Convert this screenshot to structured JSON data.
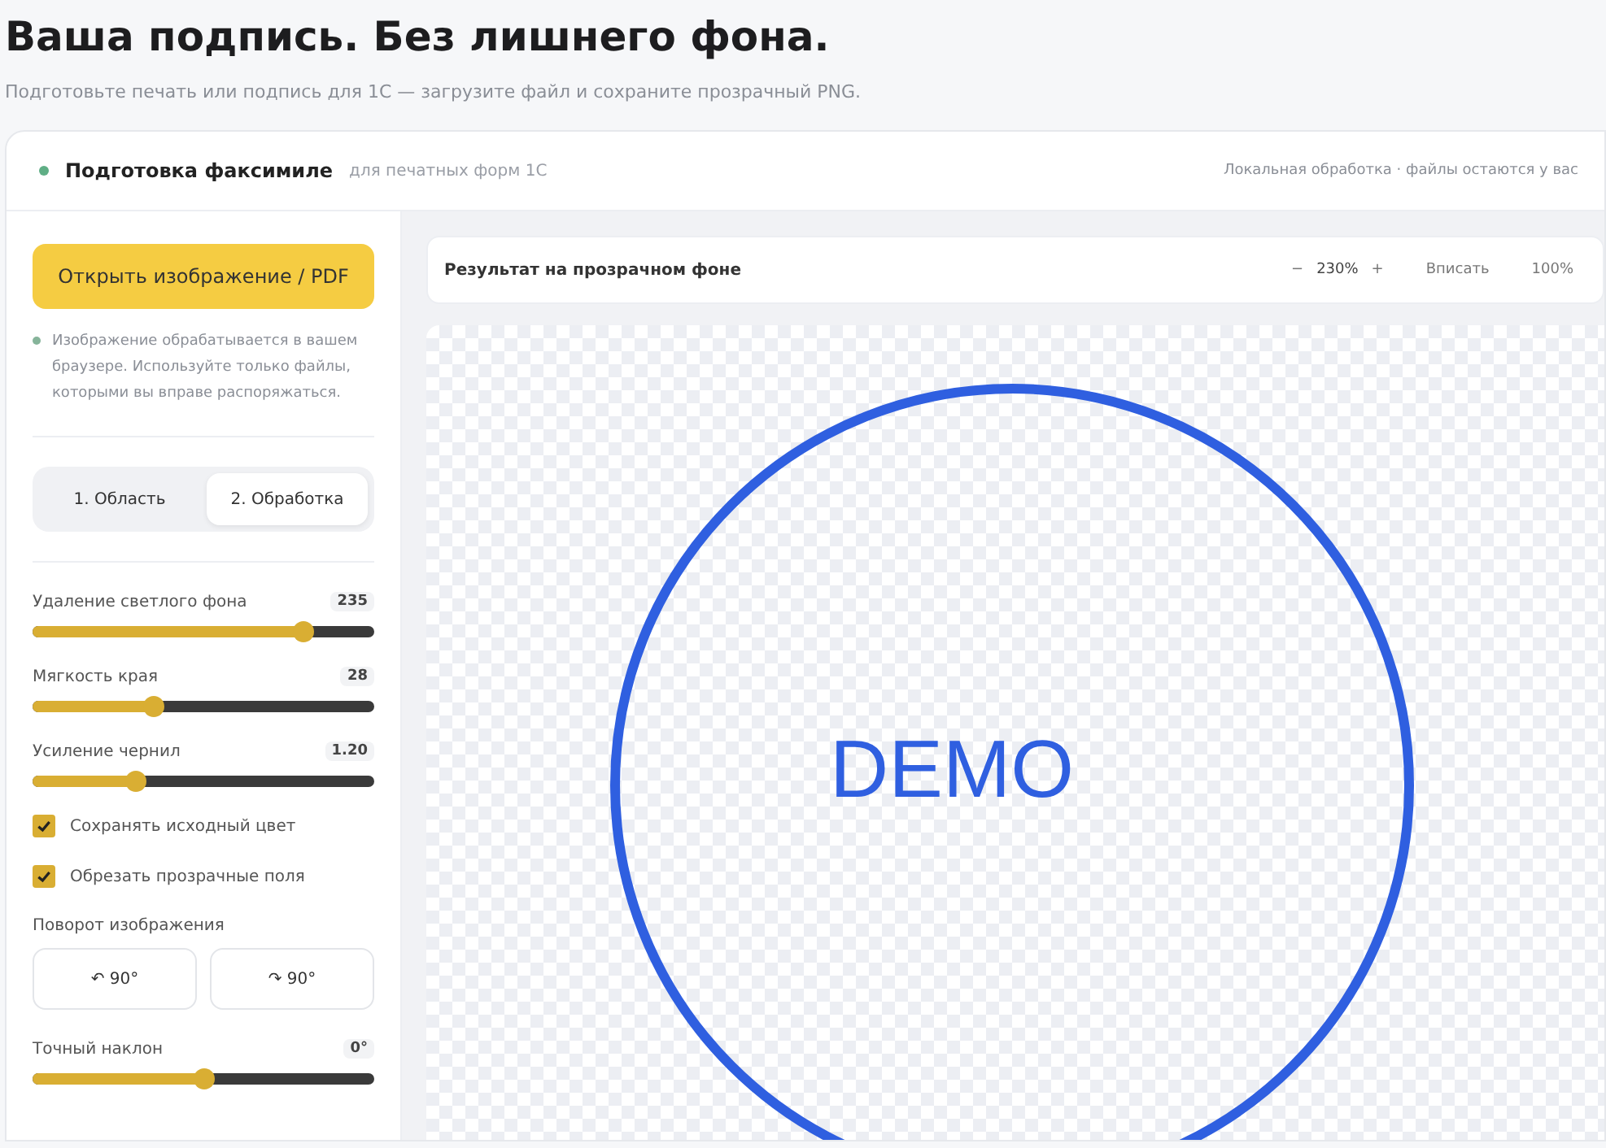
{
  "page": {
    "title": "Ваша подпись. Без лишнего фона.",
    "subtitle": "Подготовьте печать или подпись для 1С — загрузите файл и сохраните прозрачный PNG."
  },
  "header": {
    "title": "Подготовка факсимиле",
    "caption": "для печатных форм 1С",
    "note": "Локальная обработка · файлы остаются у вас"
  },
  "sidebar": {
    "open_button": "Открыть изображение / PDF",
    "info": "Изображение обрабатывается в вашем браузере. Используйте только файлы, которыми вы вправе распоряжаться.",
    "steps": [
      {
        "label": "1. Область",
        "selected": false
      },
      {
        "label": "2. Обработка",
        "selected": true
      }
    ],
    "sliders": [
      {
        "label": "Удаление светлого фона",
        "reading": "235",
        "level": 0.79
      },
      {
        "label": "Мягкость края",
        "reading": "28",
        "level": 0.35
      },
      {
        "label": "Усиление чернил",
        "reading": "1.20",
        "level": 0.3
      }
    ],
    "checkboxes": [
      {
        "label": "Сохранять исходный цвет",
        "checked": true
      },
      {
        "label": "Обрезать прозрачные поля",
        "checked": true
      }
    ],
    "rotation": {
      "label": "Поворот изображения",
      "buttons": [
        {
          "glyph": "↶",
          "label": "90°"
        },
        {
          "glyph": "↷",
          "label": "90°"
        }
      ]
    },
    "tilt": {
      "label": "Точный наклон",
      "reading": "0°",
      "level": 0.5
    }
  },
  "preview": {
    "title": "Результат на прозрачном фоне",
    "zoom_out": "−",
    "zoom": "230%",
    "zoom_in": "+",
    "fit": "Вписать",
    "actual": "100%",
    "stamp_text": "DEMO"
  }
}
